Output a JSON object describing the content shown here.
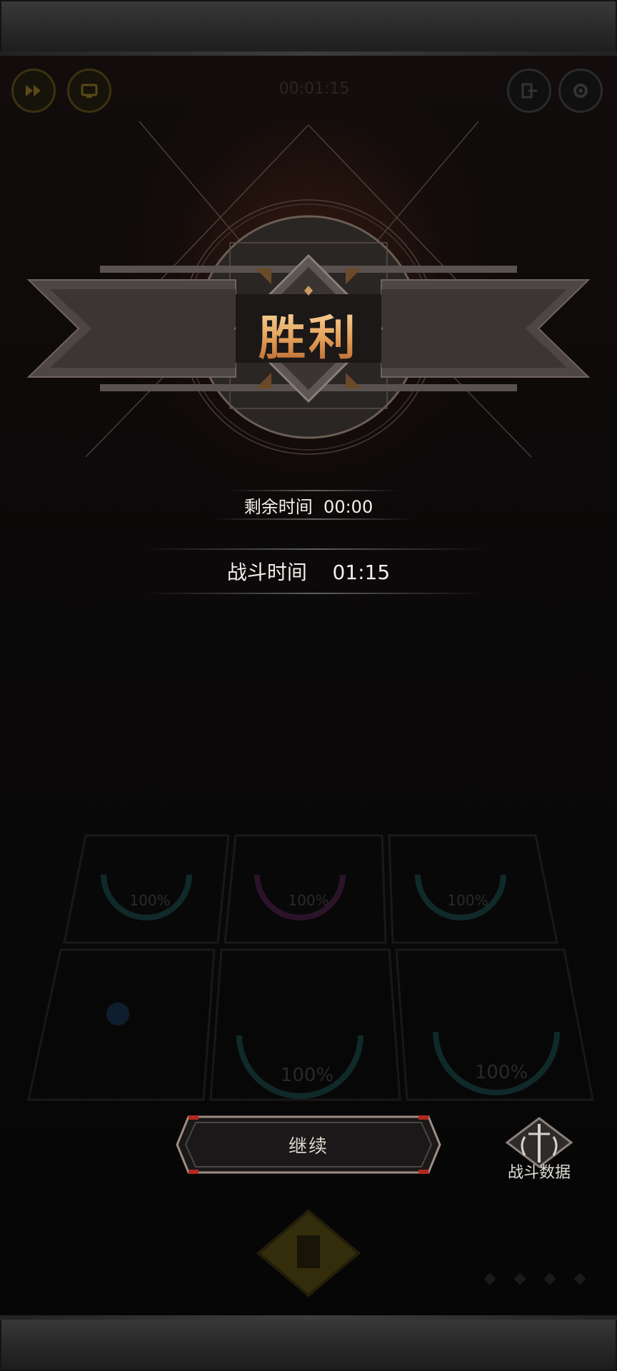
{
  "hud": {
    "left_buttons": [
      "fast-forward-icon",
      "auto-icon"
    ],
    "right_buttons": [
      "exit-icon",
      "gear-icon"
    ],
    "timer_dim": "00:01:15"
  },
  "result": {
    "title": "胜利",
    "remaining_time_label": "剩余时间",
    "remaining_time_value": "00:00",
    "battle_time_label": "战斗时间",
    "battle_time_value": "01:15"
  },
  "heroes": {
    "hp_labels": [
      "100%",
      "100%",
      "100%",
      "100%",
      "100%"
    ]
  },
  "actions": {
    "continue_label": "继续",
    "battle_data_label": "战斗数据"
  },
  "colors": {
    "title_gold": "#e3a15a",
    "button_border": "#a06a5a",
    "accent_red": "#b3281e"
  }
}
